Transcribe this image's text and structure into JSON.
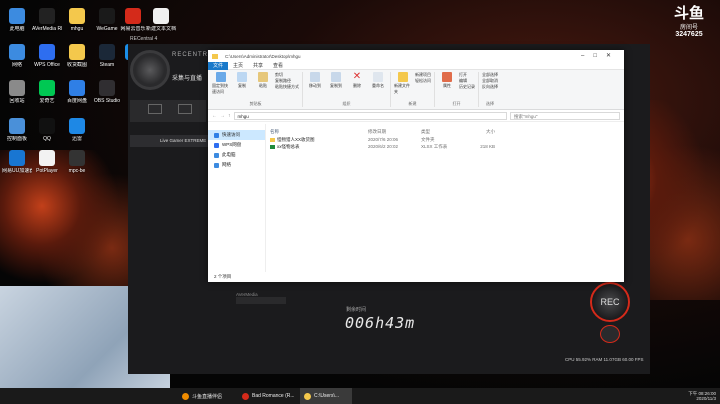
{
  "desktop_icons": [
    {
      "label": "此电脑",
      "color": "#3c8be0"
    },
    {
      "label": "AVerMedia RECentral 4",
      "color": "#222"
    },
    {
      "label": "mhgu",
      "color": "#f4c84c"
    },
    {
      "label": "WeGame",
      "color": "#1a1a1a"
    },
    {
      "label": "网易云音乐",
      "color": "#d42a1a"
    },
    {
      "label": "新建文本文档",
      "color": "#f0f0f0"
    },
    {
      "label": "网络",
      "color": "#3c8be0"
    },
    {
      "label": "WPS Office",
      "color": "#2e6ef0"
    },
    {
      "label": "收货截图",
      "color": "#f4c84c"
    },
    {
      "label": "Steam",
      "color": "#1b2838"
    },
    {
      "label": "QQ",
      "color": "#1a8ee8"
    },
    {
      "label": "回收站",
      "color": "#8a8a8a"
    },
    {
      "label": "爱奇艺",
      "color": "#00c853"
    },
    {
      "label": "百度网盘",
      "color": "#2f7fe6"
    },
    {
      "label": "OBS Studio",
      "color": "#302e31"
    },
    {
      "label": "控制面板",
      "color": "#4a90d9"
    },
    {
      "label": "QQ",
      "color": "#111"
    },
    {
      "label": "迅雷",
      "color": "#1e88e5"
    },
    {
      "label": "网易UU加速器",
      "color": "#1976d2"
    },
    {
      "label": "PotPlayer",
      "color": "#f2f2f2"
    },
    {
      "label": "mpc-be",
      "color": "#333"
    }
  ],
  "capture_app": {
    "title": "RECentral 4",
    "brand": "RECENTRAL",
    "mode_label": "采集与直播",
    "device_label": "Live Gamer EXTREME",
    "elapsed_label": "剩余时间",
    "elapsed_value": "006h43m",
    "rec_label": "REC",
    "stats": "CPU 55.92%  RAM 11.07GB  60.00 FPS",
    "source_label": "AVerMedia"
  },
  "douyu": {
    "logo": "斗鱼",
    "room_label": "房间号",
    "room_id": "3247625"
  },
  "explorer": {
    "path_title": "C:\\Users\\Administrator\\Desktop\\mhgu",
    "tabs": [
      "文件",
      "主页",
      "共享",
      "查看"
    ],
    "ribbon": {
      "clipboard": {
        "pin": "固定到快速访问",
        "copy": "复制",
        "paste": "粘贴",
        "cut": "剪切",
        "copy_path": "复制路径",
        "paste_shortcut": "粘贴快捷方式",
        "group": "剪贴板"
      },
      "organize": {
        "move_to": "移动到",
        "copy_to": "复制到",
        "delete": "删除",
        "rename": "重命名",
        "group": "组织"
      },
      "new": {
        "new_folder": "新建文件夹",
        "new_item": "新建项目",
        "easy_access": "轻松访问",
        "group": "新建"
      },
      "open": {
        "properties": "属性",
        "open": "打开",
        "edit": "编辑",
        "history": "历史记录",
        "group": "打开"
      },
      "select": {
        "select_all": "全部选择",
        "select_none": "全部取消",
        "invert": "反向选择",
        "group": "选择"
      }
    },
    "address": "mhgu",
    "search_placeholder": "搜索\"mhgu\"",
    "nav": [
      {
        "label": "快速访问",
        "color": "#2f7fe6"
      },
      {
        "label": "WPS网盘",
        "color": "#2e6ef0"
      },
      {
        "label": "此电脑",
        "color": "#3c8be0"
      },
      {
        "label": "网络",
        "color": "#3c8be0"
      }
    ],
    "columns": [
      "名称",
      "修改日期",
      "类型",
      "大小"
    ],
    "files": [
      {
        "name": "怪物猎人XX收货图",
        "date": "2020/7/6 20:06",
        "type": "文件夹",
        "size": "",
        "kind": "folder"
      },
      {
        "name": "xx怪物总表",
        "date": "2020/6/2 20:02",
        "type": "XLSX 工作表",
        "size": "218 KB",
        "kind": "xlsx"
      }
    ],
    "status": "2 个项目"
  },
  "taskbar": {
    "items": [
      {
        "label": "斗鱼直播伴侣",
        "color": "#f08c00"
      },
      {
        "label": "Bad Romance (R...",
        "color": "#d42a1a"
      },
      {
        "label": "C:\\Users\\...",
        "color": "#f4c84c"
      }
    ],
    "time": "下午 08:26:00",
    "date": "2020/11/3"
  }
}
